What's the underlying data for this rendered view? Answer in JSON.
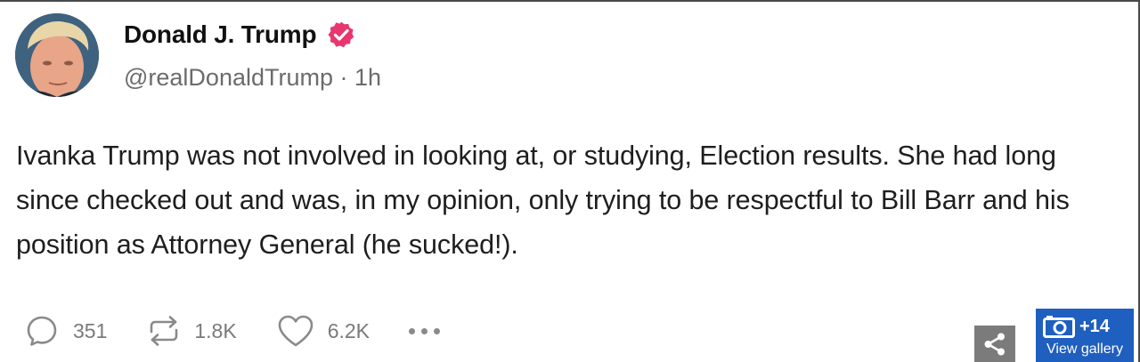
{
  "post": {
    "author": {
      "display_name": "Donald J. Trump",
      "handle": "@realDonaldTrump",
      "time_separator": "·",
      "time_ago": "1h",
      "verified_color": "#e8376f"
    },
    "body": "Ivanka Trump was not involved in looking at, or studying, Election results. She had long since checked out and was, in my opinion, only trying to be respectful to Bill Barr and his position as Attorney General (he sucked!).",
    "actions": {
      "reply_count": "351",
      "repost_count": "1.8K",
      "like_count": "6.2K"
    }
  },
  "gallery": {
    "count": "+14",
    "label": "View gallery",
    "color": "#1f5fbf"
  },
  "icons": {
    "verified": "verified-badge-icon",
    "reply": "comment-bubble-icon",
    "repost": "repost-arrows-icon",
    "like": "heart-icon",
    "more": "more-dots-icon",
    "share": "share-icon",
    "camera": "camera-icon"
  }
}
